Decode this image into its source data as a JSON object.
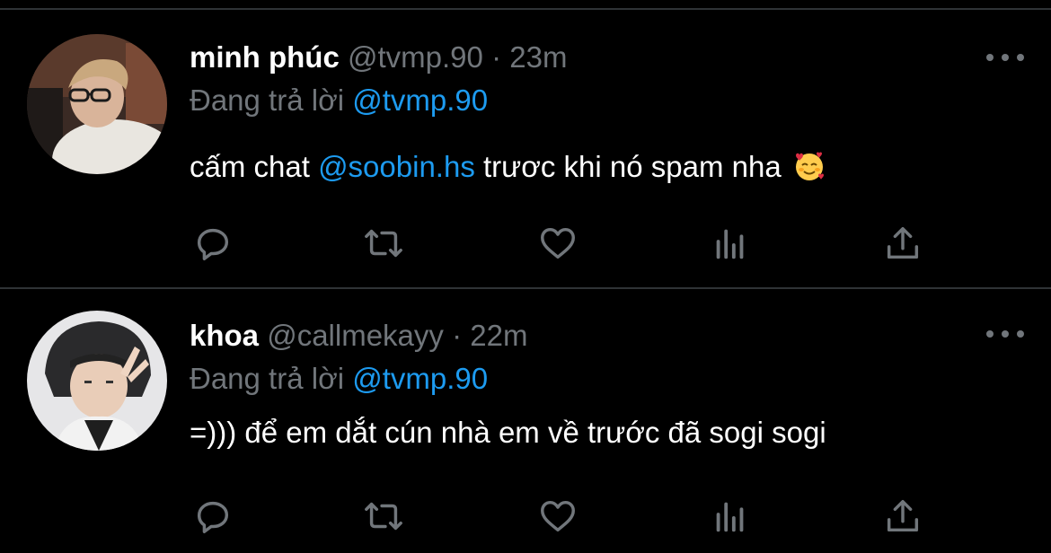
{
  "theme": {
    "background": "#000000",
    "divider": "#2f3336",
    "text_primary": "#ffffff",
    "text_secondary": "#71767b",
    "accent": "#1d9bf0"
  },
  "tweets": [
    {
      "display_name": "minh phúc",
      "handle": "@tvmp.90",
      "separator": "·",
      "time": "23m",
      "reply_prefix": "Đang trả lời",
      "reply_to": "@tvmp.90",
      "body_before": "cấm chat",
      "body_mention": "@soobin.hs",
      "body_after": "trươc khi nó spam nha",
      "emoji": "smiling-face-with-hearts",
      "actions": [
        "reply-icon",
        "retweet-icon",
        "like-icon",
        "analytics-icon",
        "share-icon"
      ]
    },
    {
      "display_name": "khoa",
      "handle": "@callmekayy",
      "separator": "·",
      "time": "22m",
      "reply_prefix": "Đang trả lời",
      "reply_to": "@tvmp.90",
      "body": "=))) để em dắt cún nhà em về trước đã sogi sogi",
      "actions": [
        "reply-icon",
        "retweet-icon",
        "like-icon",
        "analytics-icon",
        "share-icon"
      ]
    }
  ]
}
